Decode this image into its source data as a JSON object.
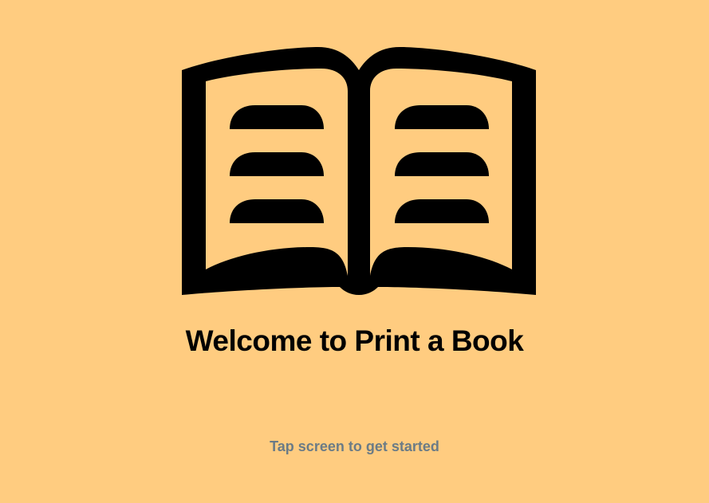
{
  "screen": {
    "background_color": "#FFCC80",
    "icon": "open-book-icon",
    "title": "Welcome to Print a Book",
    "prompt": "Tap screen to get started",
    "prompt_color": "#6B7B86"
  }
}
